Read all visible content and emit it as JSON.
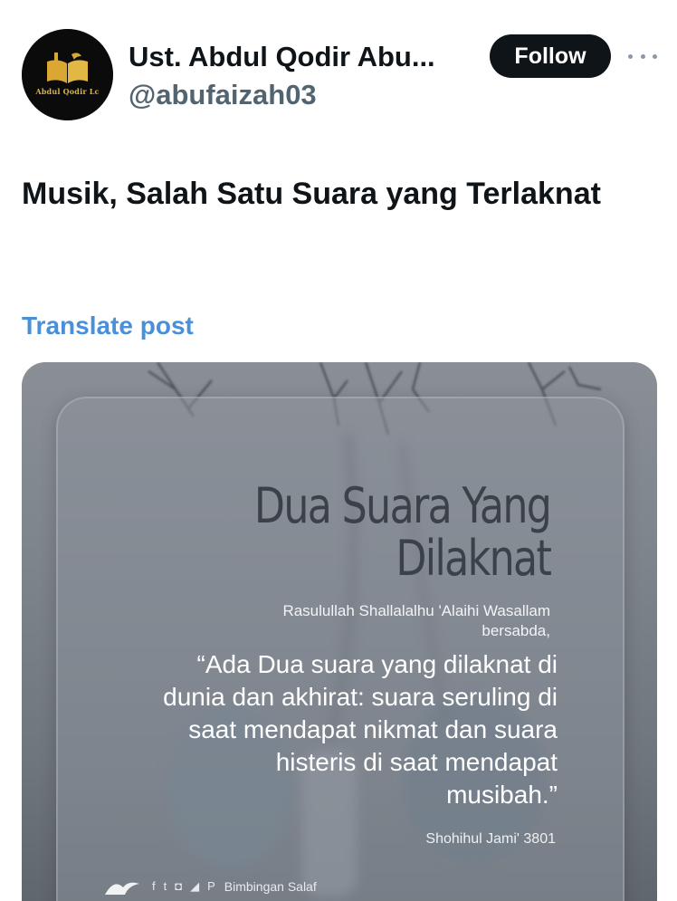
{
  "author": {
    "display_name": "Ust. Abdul Qodir Abu...",
    "handle": "@abufaizah03",
    "avatar_caption": "Abdul Qodir Lc"
  },
  "actions": {
    "follow_label": "Follow"
  },
  "post": {
    "text": "Musik, Salah Satu Suara yang Terlaknat",
    "translate_label": "Translate post"
  },
  "media": {
    "title_line1": "Dua Suara Yang",
    "title_line2": "Dilaknat",
    "subtitle": "Rasulullah Shallalalhu 'Alaihi Wasallam bersabda,",
    "quote": "“Ada Dua suara yang dilaknat di dunia dan akhirat: suara seruling di saat mendapat nikmat dan suara histeris di saat mendapat musibah.”",
    "source": "Shohihul Jami' 3801",
    "footer_brand": "Bimbingan Salaf"
  },
  "colors": {
    "follow_bg": "#0f1419",
    "link": "#4a90d9",
    "muted": "#536471"
  }
}
